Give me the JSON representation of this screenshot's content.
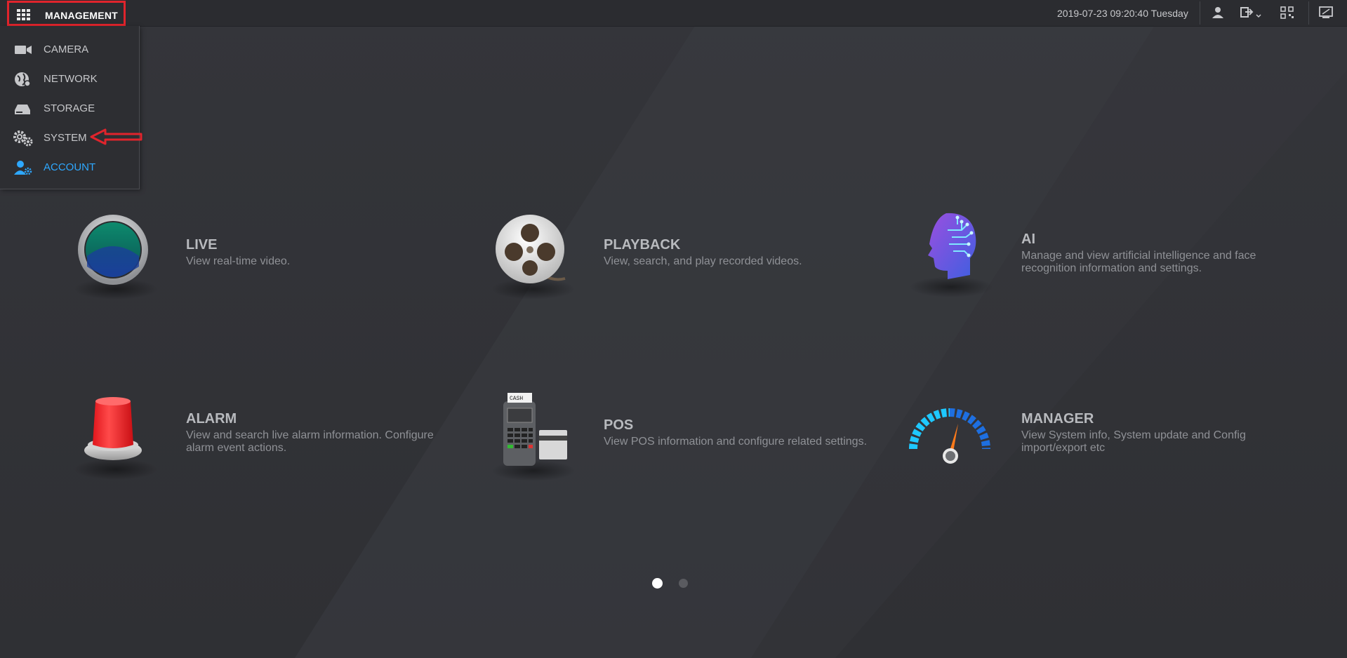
{
  "topbar": {
    "menu_title": "MANAGEMENT",
    "datetime": "2019-07-23 09:20:40 Tuesday",
    "icons": [
      "grid-icon",
      "user-icon",
      "logout-icon",
      "qr-code-icon",
      "display-icon"
    ]
  },
  "menu": {
    "items": [
      {
        "label": "CAMERA",
        "icon": "camera-icon"
      },
      {
        "label": "NETWORK",
        "icon": "network-globe-icon"
      },
      {
        "label": "STORAGE",
        "icon": "storage-drive-icon"
      },
      {
        "label": "SYSTEM",
        "icon": "gears-icon"
      },
      {
        "label": "ACCOUNT",
        "icon": "account-user-icon",
        "active": true
      }
    ]
  },
  "tiles": [
    {
      "title": "LIVE",
      "desc": "View real-time video."
    },
    {
      "title": "PLAYBACK",
      "desc": "View, search, and play recorded videos."
    },
    {
      "title": "AI",
      "desc": "Manage and view artificial intelligence and face recognition information and settings."
    },
    {
      "title": "ALARM",
      "desc": "View and search live alarm information. Configure alarm event actions."
    },
    {
      "title": "POS",
      "desc": "View POS information and configure related settings."
    },
    {
      "title": "MANAGER",
      "desc": "View System info, System update and Config import/export etc"
    }
  ],
  "pos_icon_text": {
    "cash": "CASH"
  },
  "pager": {
    "page_count": 2,
    "current_page": 1
  },
  "colors": {
    "accent_blue": "#2ea8ff",
    "highlight_red": "#e0242c",
    "background": "#35363a"
  }
}
